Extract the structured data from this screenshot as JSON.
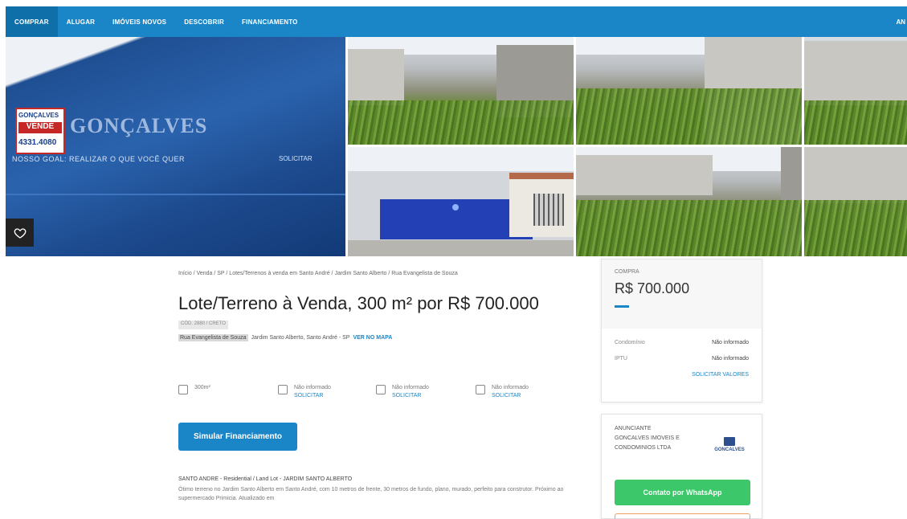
{
  "nav": {
    "items": [
      {
        "label": "COMPRAR"
      },
      {
        "label": "ALUGAR"
      },
      {
        "label": "IMÓVEIS NOVOS"
      },
      {
        "label": "DESCOBRIR"
      },
      {
        "label": "FINANCIAMENTO"
      }
    ],
    "right_label": "AN"
  },
  "gallery": {
    "main_photo": {
      "sign_top": "GONÇALVES",
      "sign_middle": "VENDE",
      "sign_bottom": "4331.4080",
      "brand": "GONÇALVES",
      "slogan": "NOSSO GOAL: REALIZAR O QUE VOCÊ QUER",
      "slogan_right": "SOLICITAR"
    }
  },
  "breadcrumb": "Início / Venda / SP / Lotes/Terrenos à venda em Santo André / Jardim Santo Alberto / Rua Evangelista de Souza",
  "title": "Lote/Terreno à Venda, 300 m² por R$ 700.000",
  "code": "CÓD. 2880 / CRETO",
  "address": {
    "street": "Rua Evangelista de Souza",
    "rest": "Jardim Santo Alberto, Santo André - SP",
    "map_link": "VER NO MAPA"
  },
  "features": [
    {
      "icon": "area-icon",
      "value": "300m²",
      "link": ""
    },
    {
      "icon": "bed-icon",
      "value": "Não informado",
      "link": "SOLICITAR"
    },
    {
      "icon": "shower-icon",
      "value": "Não informado",
      "link": "SOLICITAR"
    },
    {
      "icon": "car-icon",
      "value": "Não informado",
      "link": "SOLICITAR"
    }
  ],
  "simulate_button": "Simular Financiamento",
  "description": {
    "title": "SANTO ANDRE - Residential / Land Lot - JARDIM SANTO ALBERTO",
    "text": "Ótimo terreno no Jardim Santo Alberto em Santo André, com 10 metros de frente, 30 metros de fundo, plano, murado, perfeito para construtor. Próximo ao supermercado Primicia. Atualizado em"
  },
  "price_card": {
    "label": "COMPRA",
    "price": "R$ 700.000",
    "rows": [
      {
        "key": "Condomínio",
        "value": "Não informado"
      },
      {
        "key": "IPTU",
        "value": "Não informado"
      }
    ],
    "request": "SOLICITAR VALORES"
  },
  "advertiser": {
    "label": "ANUNCIANTE",
    "name": "GONCALVES IMOVEIS E CONDOMINIOS LTDA",
    "logo_text": "GONCALVES",
    "whatsapp_button": "Contato por WhatsApp"
  },
  "colors": {
    "nav": "#1a86c8",
    "accent": "#1a86c8",
    "whatsapp": "#3cc86a"
  }
}
